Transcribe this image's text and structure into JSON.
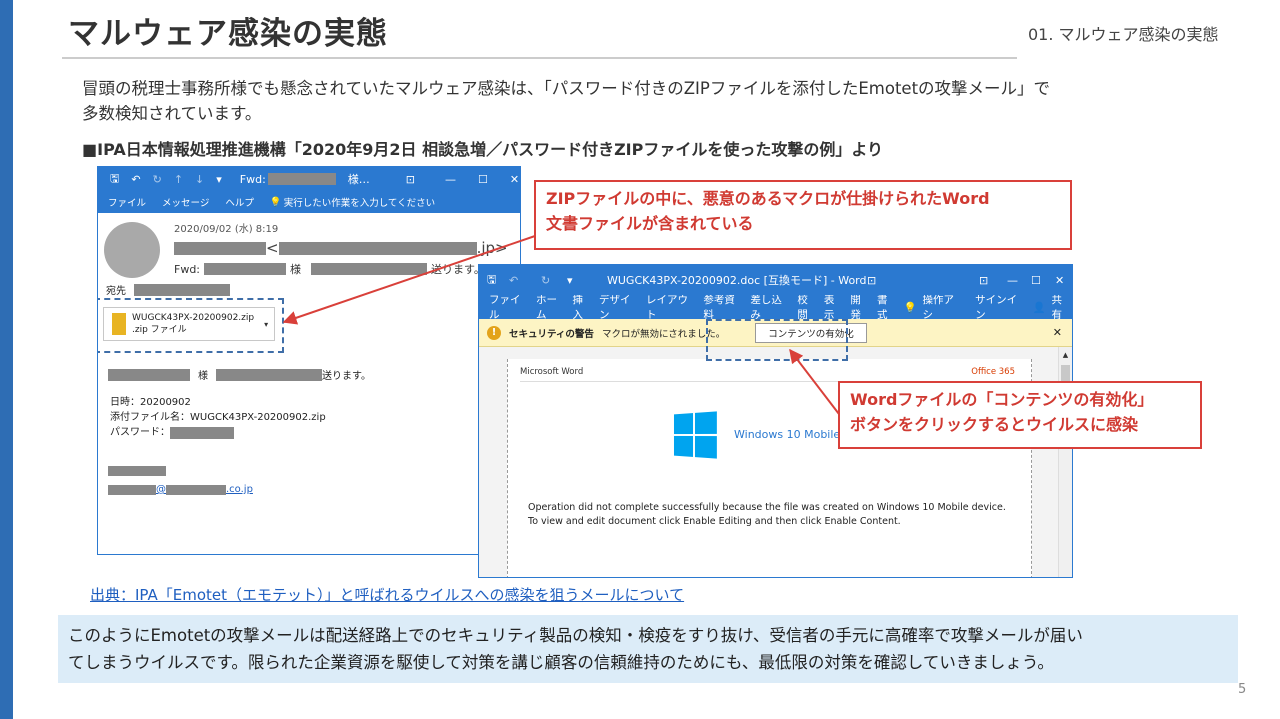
{
  "header": {
    "title": "マルウェア感染の実態",
    "section": "01. マルウェア感染の実態"
  },
  "intro": {
    "line1": "冒頭の税理士事務所様でも懸念されていたマルウェア感染は、「パスワード付きのZIPファイルを添付したEmotetの攻撃メール」で",
    "line2": "多数検知されています。"
  },
  "source_heading": "■IPA日本情報処理推進機構「2020年9月2日 相談急増／パスワード付きZIPファイルを使った攻撃の例」より",
  "mail": {
    "title_fwd": "Fwd:",
    "title_sama": "様…",
    "menu": [
      "ファイル",
      "メッセージ",
      "ヘルプ"
    ],
    "tell_me": "実行したい作業を入力してください",
    "date": "2020/09/02 (水) 8:19",
    "from_suffix": ".jp>",
    "from_lt": "<",
    "subject_fwd": "Fwd:",
    "subject_sama": "様",
    "subject_tail": "送ります。",
    "to_label": "宛先",
    "attachment_name": "WUGCK43PX-20200902.zip",
    "attachment_type": ".zip ファイル",
    "body_sama": "様",
    "body_tail": "送ります。",
    "date_line": "日時：20200902",
    "file_line": "添付ファイル名：WUGCK43PX-20200902.zip",
    "password_label": "パスワード：",
    "email_at": "@",
    "email_tail": ".co.jp"
  },
  "word": {
    "title": "WUGCK43PX-20200902.doc [互換モード] - Word",
    "menu": [
      "ファイル",
      "ホーム",
      "挿入",
      "デザイン",
      "レイアウト",
      "参考資料",
      "差し込み",
      "校閲",
      "表示",
      "開発",
      "書式"
    ],
    "tell_me": "操作アシ",
    "signin": "サインイン",
    "share": "共有",
    "security_label": "セキュリティの警告",
    "security_msg": "マクロが無効にされました。",
    "enable_button": "コンテンツの有効化",
    "doc_brand": "Microsoft Word",
    "office": "Office 365",
    "windows": "Windows 10 Mobile",
    "msg1": "Operation did not complete successfully because the file was created on Windows 10 Mobile device.",
    "msg2": "To view and edit document click Enable Editing and then click Enable Content."
  },
  "callouts": {
    "zip_line1": "ZIPファイルの中に、悪意のあるマクロが仕掛けられたWord",
    "zip_line2": "文書ファイルが含まれている",
    "word_line1": "Wordファイルの「コンテンツの有効化」",
    "word_line2": "ボタンをクリックするとウイルスに感染"
  },
  "citation": "出典：IPA「Emotet（エモテット）」と呼ばれるウイルスへの感染を狙うメールについて",
  "conclusion": {
    "line1": "このようにEmotetの攻撃メールは配送経路上でのセキュリティ製品の検知・検疫をすり抜け、受信者の手元に高確率で攻撃メールが届い",
    "line2": "てしまうウイルスです。限られた企業資源を駆使して対策を講じ顧客の信頼維持のためにも、最低限の対策を確認していきましょう。"
  },
  "page_number": "5",
  "colors": {
    "accent": "#2e6db4",
    "callout": "#d9403a",
    "conclusion_bg": "#dcecf8"
  }
}
